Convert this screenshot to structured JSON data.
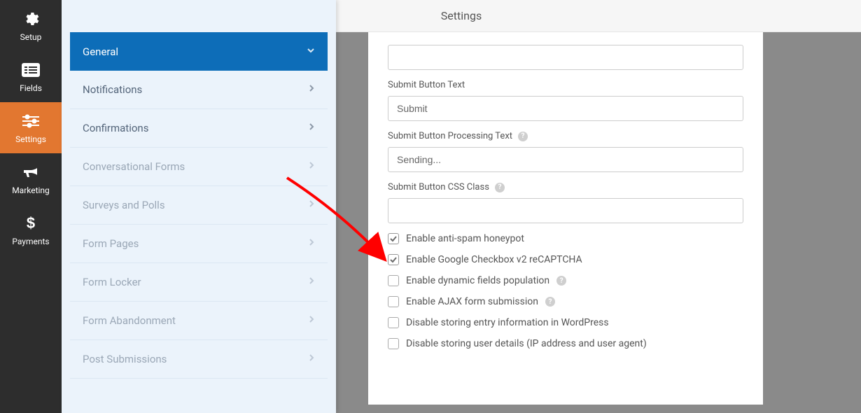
{
  "header": {
    "title": "Settings"
  },
  "iconbar": {
    "items": [
      {
        "label": "Setup",
        "icon": "gear-icon"
      },
      {
        "label": "Fields",
        "icon": "list-icon"
      },
      {
        "label": "Settings",
        "icon": "sliders-icon",
        "active": true
      },
      {
        "label": "Marketing",
        "icon": "bullhorn-icon"
      },
      {
        "label": "Payments",
        "icon": "dollar-icon"
      }
    ]
  },
  "panel": {
    "items": [
      {
        "label": "General",
        "active": true,
        "chevron": "down"
      },
      {
        "label": "Notifications",
        "chevron": "right"
      },
      {
        "label": "Confirmations",
        "chevron": "right"
      },
      {
        "label": "Conversational Forms",
        "chevron": "right",
        "muted": true
      },
      {
        "label": "Surveys and Polls",
        "chevron": "right",
        "muted": true
      },
      {
        "label": "Form Pages",
        "chevron": "right",
        "muted": true
      },
      {
        "label": "Form Locker",
        "chevron": "right",
        "muted": true
      },
      {
        "label": "Form Abandonment",
        "chevron": "right",
        "muted": true
      },
      {
        "label": "Post Submissions",
        "chevron": "right",
        "muted": true
      }
    ]
  },
  "form": {
    "submit_button_text": {
      "label": "Submit Button Text",
      "value": "Submit"
    },
    "submit_button_processing": {
      "label": "Submit Button Processing Text",
      "value": "Sending..."
    },
    "submit_button_css": {
      "label": "Submit Button CSS Class",
      "value": ""
    },
    "checkboxes": [
      {
        "label": "Enable anti-spam honeypot",
        "checked": true,
        "help": false
      },
      {
        "label": "Enable Google Checkbox v2 reCAPTCHA",
        "checked": true,
        "help": false
      },
      {
        "label": "Enable dynamic fields population",
        "checked": false,
        "help": true
      },
      {
        "label": "Enable AJAX form submission",
        "checked": false,
        "help": true
      },
      {
        "label": "Disable storing entry information in WordPress",
        "checked": false,
        "help": false
      },
      {
        "label": "Disable storing user details (IP address and user agent)",
        "checked": false,
        "help": false
      }
    ]
  }
}
